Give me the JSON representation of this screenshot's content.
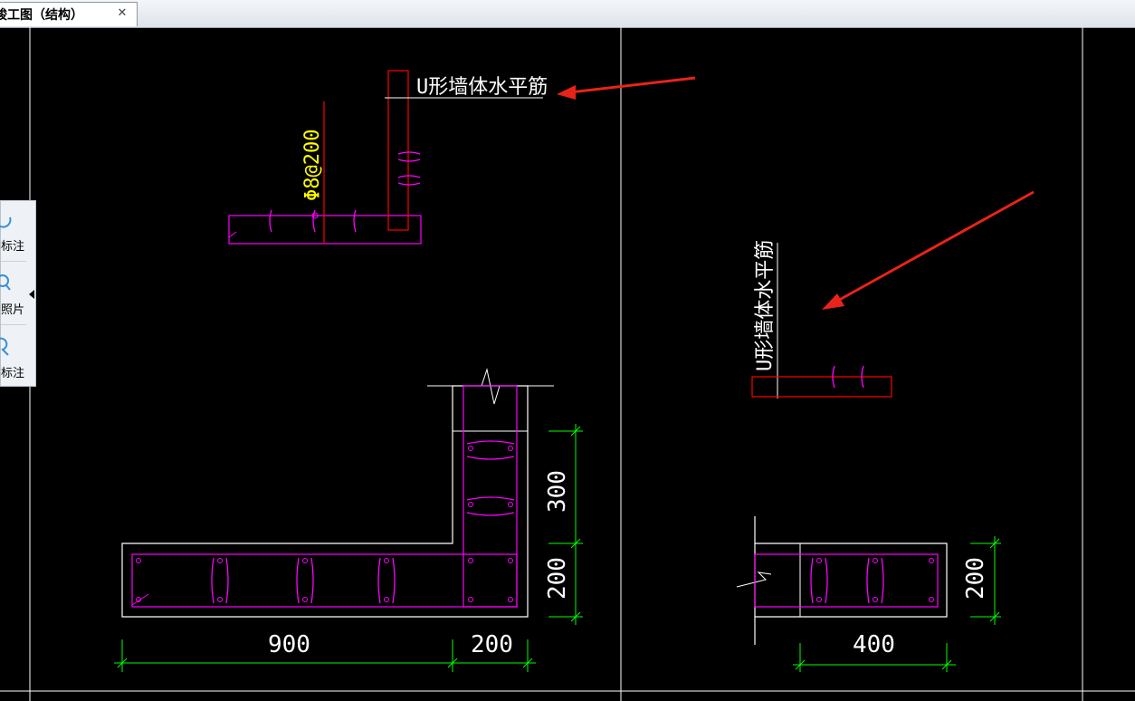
{
  "tab": {
    "title": "竣工图（结构）",
    "close_symbol": "✕"
  },
  "side_panel": {
    "items": [
      {
        "label": "标注",
        "icon": "measure-icon"
      },
      {
        "label": "照片",
        "icon": "zoom-photo-icon"
      },
      {
        "label": "标注",
        "icon": "annotation-icon"
      }
    ],
    "collapse_icon": "triangle-left-icon"
  },
  "drawing": {
    "labels": {
      "u_wall_top": "U形墙体水平筋",
      "u_wall_right": "U形墙体水平筋",
      "rebar_spec": "Φ8@200"
    },
    "dimensions": {
      "left_bottom_900": "900",
      "left_bottom_200": "200",
      "left_vertical_300": "300",
      "left_vertical_200": "200",
      "right_bottom_400": "400",
      "right_vertical_200": "200"
    },
    "colors": {
      "background": "#000000",
      "outline": "#ffffff",
      "rebar": "#ff00ff",
      "stirrup_red": "#ff0000",
      "dimension": "#00ff00",
      "spec_text": "#ffff00",
      "arrow": "#e8231a"
    }
  }
}
